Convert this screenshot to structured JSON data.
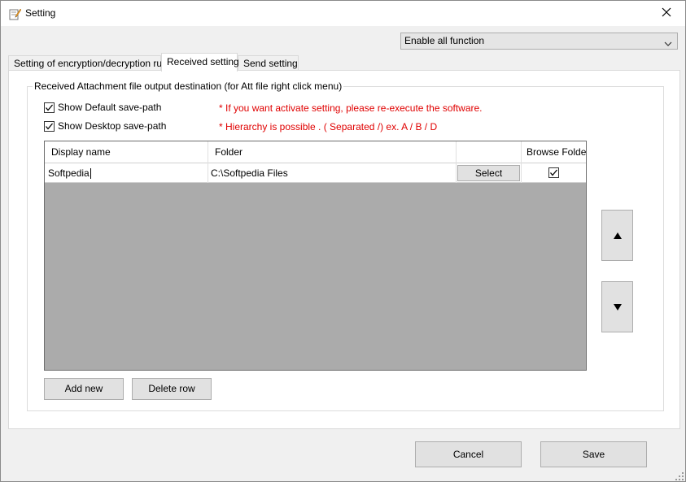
{
  "window": {
    "title": "Setting"
  },
  "mode_select": {
    "value": "Enable all function"
  },
  "tabs": [
    {
      "label": "Setting of encryption/decryption rules",
      "active": false
    },
    {
      "label": "Received setting",
      "active": true
    },
    {
      "label": "Send setting",
      "active": false
    }
  ],
  "group": {
    "title": "Received Attachment file output destination (for Att file right click menu)",
    "show_default": {
      "label": "Show Default save-path",
      "checked": true
    },
    "show_desktop": {
      "label": "Show Desktop save-path",
      "checked": true
    },
    "note1": "* If you want activate setting, please re-execute the software.",
    "note2": "* Hierarchy is possible . ( Separated /) ex. A / B / D"
  },
  "grid": {
    "columns": [
      "Display name",
      "Folder",
      "",
      "Browse Folder"
    ],
    "rows": [
      {
        "display_name": "Softpedia",
        "folder": "C:\\Softpedia Files",
        "button": "Select",
        "browse_folder": true
      }
    ]
  },
  "buttons": {
    "add_new": "Add new",
    "delete_row": "Delete row",
    "cancel": "Cancel",
    "save": "Save"
  },
  "icons": {
    "app": "pencil-paper-icon",
    "close": "close-icon",
    "dropdown": "chevron-down-icon",
    "up": "triangle-up-icon",
    "down": "triangle-down-icon"
  },
  "colors": {
    "note_red": "#e00000",
    "grid_empty": "#ababab"
  }
}
